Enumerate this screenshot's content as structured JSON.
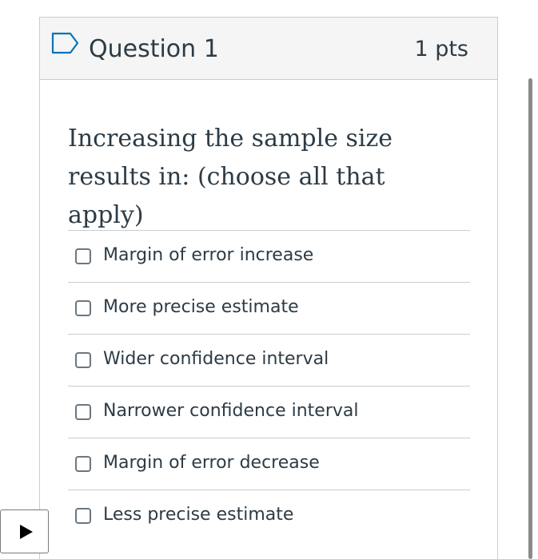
{
  "question": {
    "title": "Question 1",
    "points": "1 pts",
    "text": "Increasing the sample size results in: (choose all that apply)"
  },
  "answers": [
    {
      "label": "Margin of error increase",
      "checked": false
    },
    {
      "label": "More precise estimate",
      "checked": false
    },
    {
      "label": "Wider confidence interval",
      "checked": false
    },
    {
      "label": "Narrower confidence interval",
      "checked": false
    },
    {
      "label": "Margin of error decrease",
      "checked": false
    },
    {
      "label": "Less precise estimate",
      "checked": false
    }
  ],
  "icons": {
    "flag": "bookmark-flag-icon",
    "play": "play-icon"
  },
  "colors": {
    "text": "#2d3b45",
    "border": "#c7cdd1",
    "header_bg": "#f5f5f5",
    "flag_stroke": "#0374b5"
  }
}
